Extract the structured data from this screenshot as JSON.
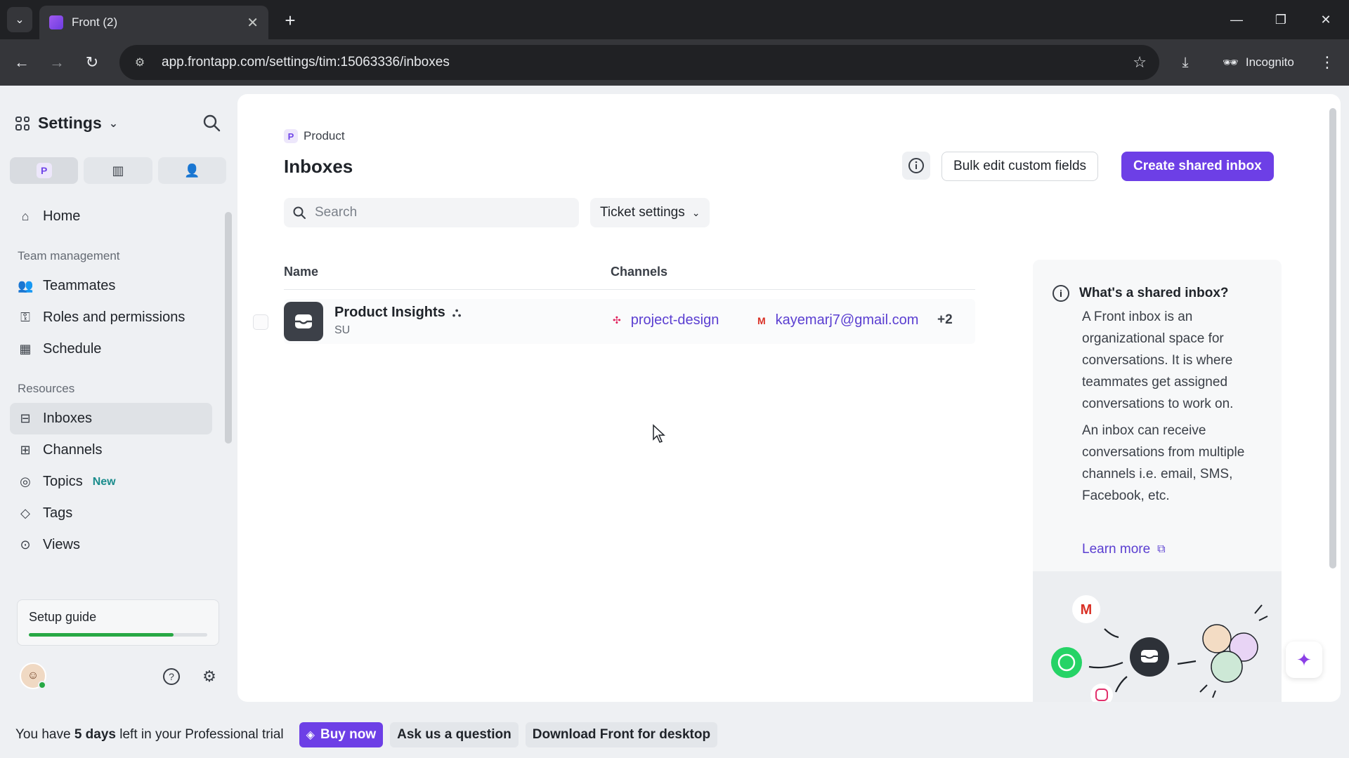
{
  "browser": {
    "tab_title": "Front (2)",
    "url": "app.frontapp.com/settings/tim:15063336/inboxes",
    "incognito_label": "Incognito"
  },
  "sidebar": {
    "title": "Settings",
    "workspace_badge": "P",
    "items_top": [
      {
        "label": "Home",
        "icon": "home-icon"
      }
    ],
    "team_section": "Team management",
    "team_items": [
      {
        "label": "Teammates",
        "icon": "people-icon"
      },
      {
        "label": "Roles and permissions",
        "icon": "user-lock-icon"
      },
      {
        "label": "Schedule",
        "icon": "calendar-icon"
      }
    ],
    "resources_section": "Resources",
    "resource_items": [
      {
        "label": "Inboxes",
        "icon": "inbox-icon"
      },
      {
        "label": "Channels",
        "icon": "grid-icon"
      },
      {
        "label": "Topics",
        "icon": "topics-icon",
        "badge": "New"
      },
      {
        "label": "Tags",
        "icon": "tag-icon"
      },
      {
        "label": "Views",
        "icon": "views-icon"
      }
    ],
    "setup_guide": {
      "label": "Setup guide",
      "progress": 0.81
    }
  },
  "main": {
    "breadcrumb": "Product",
    "breadcrumb_badge": "P",
    "title": "Inboxes",
    "bulk_edit_label": "Bulk edit custom fields",
    "create_label": "Create shared inbox",
    "search_placeholder": "Search",
    "ticket_settings_label": "Ticket settings",
    "columns": {
      "name": "Name",
      "channels": "Channels"
    },
    "rows": [
      {
        "name": "Product Insights",
        "sub": "SU",
        "channels": [
          {
            "label": "project-design",
            "icon": "slack-icon"
          },
          {
            "label": "kayemarj7@gmail.com",
            "icon": "gmail-icon"
          }
        ],
        "more": "+2"
      }
    ]
  },
  "info_panel": {
    "title": "What's a shared inbox?",
    "p1": "A Front inbox is an organizational space for conversations. It is where teammates get assigned conversations to work on.",
    "p2": "An inbox can receive conversations from multiple channels i.e. email, SMS, Facebook, etc.",
    "learn_more": "Learn more"
  },
  "trial_bar": {
    "prefix": "You have",
    "days": "5 days",
    "suffix": "left in your Professional trial",
    "buy_now": "Buy now",
    "ask": "Ask us a question",
    "download": "Download Front for desktop"
  },
  "colors": {
    "accent": "#6d3fe6",
    "link": "#5a3ed1",
    "progress": "#27a844"
  }
}
